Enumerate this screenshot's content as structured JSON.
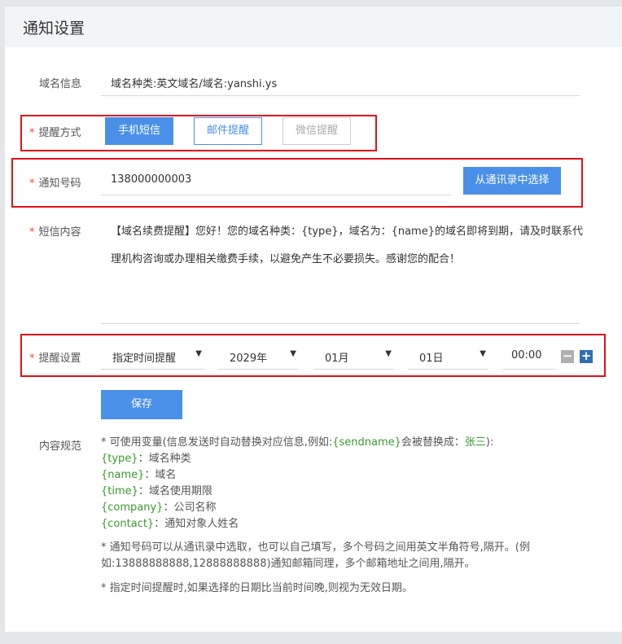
{
  "header": {
    "title": "通知设置"
  },
  "domain_info": {
    "label": "域名信息",
    "value": "域名种类:英文域名/域名:yanshi.ys"
  },
  "remind_method": {
    "label": "提醒方式",
    "options": [
      "手机短信",
      "邮件提醒",
      "微信提醒"
    ]
  },
  "notify_number": {
    "label": "通知号码",
    "value": "138000000003",
    "button": "从通讯录中选择"
  },
  "sms_content": {
    "label": "短信内容",
    "text": "【域名续费提醒】您好！您的域名种类：{type}，域名为：{name}的域名即将到期，请及时联系代理机构咨询或办理相关缴费手续，以避免产生不必要损失。感谢您的配合！"
  },
  "remind_setting": {
    "label": "提醒设置",
    "mode": "指定时间提醒",
    "year": "2029年",
    "month": "01月",
    "day": "01日",
    "time": "00:00",
    "minus": "−",
    "plus": "+"
  },
  "save_button": "保存",
  "content_rules": {
    "label": "内容规范",
    "intro_prefix": "* 可使用变量(信息发送时自动替换对应信息,例如:",
    "intro_var": "{sendname}",
    "intro_mid": "会被替换成：",
    "intro_example": "张三",
    "intro_suffix": "):",
    "vars": [
      {
        "name": "{type}",
        "desc": "：域名种类"
      },
      {
        "name": "{name}",
        "desc": "：域名"
      },
      {
        "name": "{time}",
        "desc": "：域名使用期限"
      },
      {
        "name": "{company}",
        "desc": "：公司名称"
      },
      {
        "name": "{contact}",
        "desc": "：通知对象人姓名"
      }
    ],
    "note1_line1": "* 通知号码可以从通讯录中选取，也可以自己填写，多个号码之间用英文半角符号,隔开。(例",
    "note1_line2": "如:13888888888,12888888888)通知邮箱同理，多个邮箱地址之间用,隔开。",
    "note2": "* 指定时间提醒时,如果选择的日期比当前时间晚,则视为无效日期。"
  },
  "colors": {
    "primary": "#4a90e8",
    "required": "#e74c3c",
    "highlight_box": "#e0101a",
    "variable": "#3a9a2e"
  }
}
